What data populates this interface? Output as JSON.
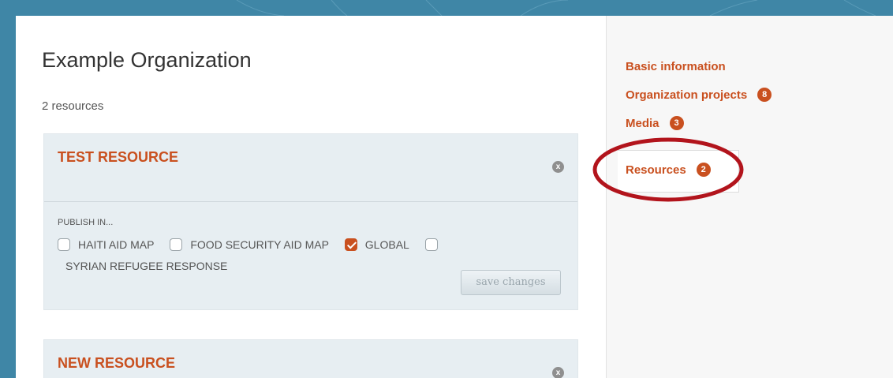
{
  "page": {
    "title": "Example Organization",
    "resource_count": "2 resources"
  },
  "resources": [
    {
      "title": "TEST RESOURCE",
      "close_glyph": "x",
      "publish_label": "PUBLISH IN...",
      "options": [
        {
          "label": "HAITI AID MAP",
          "checked": false
        },
        {
          "label": "FOOD SECURITY AID MAP",
          "checked": false
        },
        {
          "label": "GLOBAL",
          "checked": true
        },
        {
          "label": "SYRIAN REFUGEE RESPONSE",
          "checked": false
        }
      ],
      "save_label": "save changes"
    },
    {
      "title": "NEW RESOURCE",
      "close_glyph": "x"
    }
  ],
  "sidebar": {
    "items": [
      {
        "label": "Basic information",
        "badge": ""
      },
      {
        "label": "Organization projects",
        "badge": "8"
      },
      {
        "label": "Media",
        "badge": "3"
      },
      {
        "label": "Resources",
        "badge": "2"
      }
    ]
  },
  "colors": {
    "accent": "#c9501f",
    "background": "#3f86a6",
    "card": "#e7eef2",
    "highlight": "#b2141c"
  }
}
